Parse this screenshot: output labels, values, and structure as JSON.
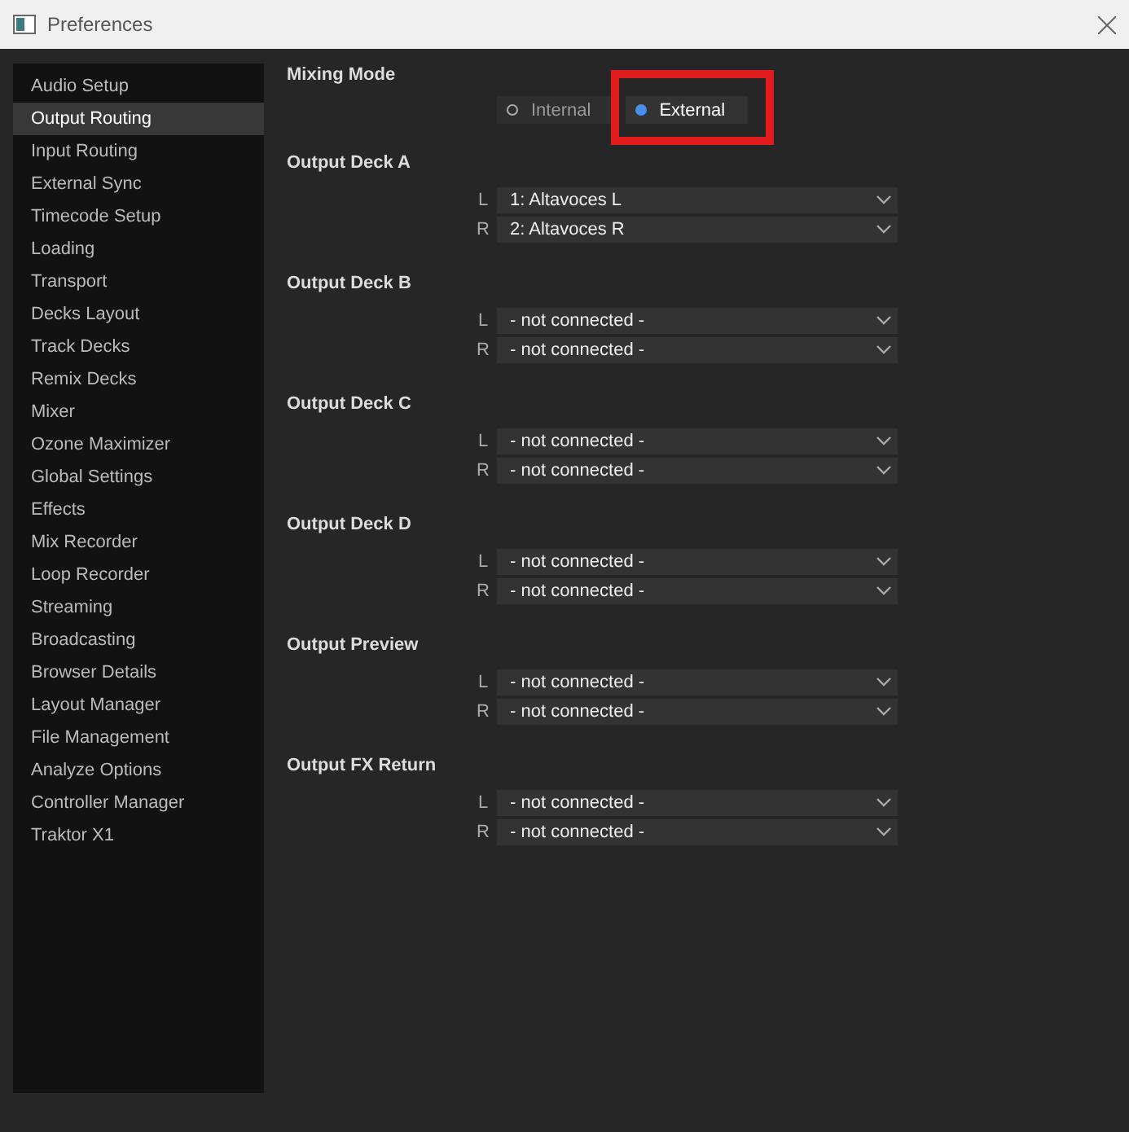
{
  "window": {
    "title": "Preferences"
  },
  "sidebar": {
    "items": [
      {
        "label": "Audio Setup",
        "selected": false
      },
      {
        "label": "Output Routing",
        "selected": true
      },
      {
        "label": "Input Routing",
        "selected": false
      },
      {
        "label": "External Sync",
        "selected": false
      },
      {
        "label": "Timecode Setup",
        "selected": false
      },
      {
        "label": "Loading",
        "selected": false
      },
      {
        "label": "Transport",
        "selected": false
      },
      {
        "label": "Decks Layout",
        "selected": false
      },
      {
        "label": "Track Decks",
        "selected": false
      },
      {
        "label": "Remix Decks",
        "selected": false
      },
      {
        "label": "Mixer",
        "selected": false
      },
      {
        "label": "Ozone Maximizer",
        "selected": false
      },
      {
        "label": "Global Settings",
        "selected": false
      },
      {
        "label": "Effects",
        "selected": false
      },
      {
        "label": "Mix Recorder",
        "selected": false
      },
      {
        "label": "Loop Recorder",
        "selected": false
      },
      {
        "label": "Streaming",
        "selected": false
      },
      {
        "label": "Broadcasting",
        "selected": false
      },
      {
        "label": "Browser Details",
        "selected": false
      },
      {
        "label": "Layout Manager",
        "selected": false
      },
      {
        "label": "File Management",
        "selected": false
      },
      {
        "label": "Analyze Options",
        "selected": false
      },
      {
        "label": "Controller Manager",
        "selected": false
      },
      {
        "label": "Traktor X1",
        "selected": false
      }
    ]
  },
  "mixing_mode": {
    "label": "Mixing Mode",
    "options": [
      {
        "label": "Internal",
        "selected": false,
        "highlighted": false
      },
      {
        "label": "External",
        "selected": true,
        "highlighted": true
      }
    ]
  },
  "outputs": [
    {
      "title": "Output Deck A",
      "channels": [
        {
          "side": "L",
          "value": "1: Altavoces L"
        },
        {
          "side": "R",
          "value": "2: Altavoces R"
        }
      ]
    },
    {
      "title": "Output Deck B",
      "channels": [
        {
          "side": "L",
          "value": "- not connected -"
        },
        {
          "side": "R",
          "value": "- not connected -"
        }
      ]
    },
    {
      "title": "Output Deck C",
      "channels": [
        {
          "side": "L",
          "value": "- not connected -"
        },
        {
          "side": "R",
          "value": "- not connected -"
        }
      ]
    },
    {
      "title": "Output Deck D",
      "channels": [
        {
          "side": "L",
          "value": "- not connected -"
        },
        {
          "side": "R",
          "value": "- not connected -"
        }
      ]
    },
    {
      "title": "Output Preview",
      "channels": [
        {
          "side": "L",
          "value": "- not connected -"
        },
        {
          "side": "R",
          "value": "- not connected -"
        }
      ]
    },
    {
      "title": "Output FX Return",
      "channels": [
        {
          "side": "L",
          "value": "- not connected -"
        },
        {
          "side": "R",
          "value": "- not connected -"
        }
      ]
    }
  ]
}
